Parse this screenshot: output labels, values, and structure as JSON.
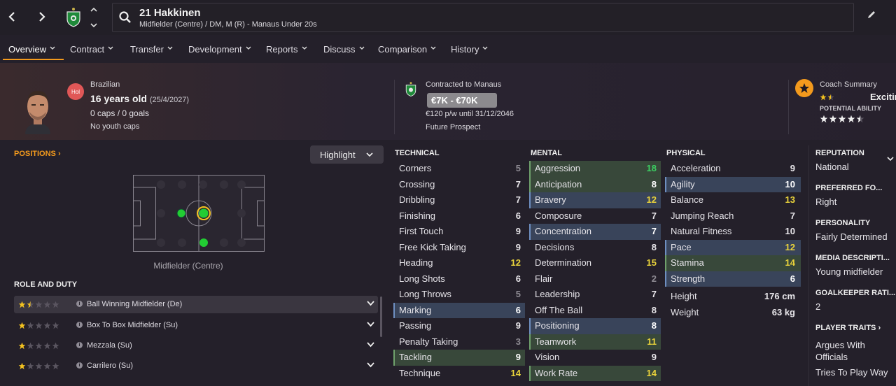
{
  "header": {
    "player_name": "21 Hakkinen",
    "player_sub": "Midfielder (Centre) / DM, M (R) - Manaus Under 20s"
  },
  "tabs": [
    {
      "label": "Overview"
    },
    {
      "label": "Contract"
    },
    {
      "label": "Transfer"
    },
    {
      "label": "Development"
    },
    {
      "label": "Reports"
    },
    {
      "label": "Discuss"
    },
    {
      "label": "Comparison"
    },
    {
      "label": "History"
    }
  ],
  "profile": {
    "badge": "Hol",
    "nationality": "Brazilian",
    "age": "16 years old",
    "dob": "(25/4/2027)",
    "caps": "0 caps / 0 goals",
    "youth_caps": "No youth caps"
  },
  "contract": {
    "club": "Contracted to Manaus",
    "value": "€7K - €70K",
    "wage": "€120 p/w until 31/12/2046",
    "status": "Future Prospect"
  },
  "coach": {
    "title": "Coach Summary",
    "verdict": "Excitin",
    "potential_label": "POTENTIAL ABILITY",
    "current_stars": 1.5,
    "potential_stars": 4.5
  },
  "positions": {
    "label": "POSITIONS",
    "highlight": "Highlight",
    "pitch_label": "Midfielder (Centre)"
  },
  "roles": {
    "header": "ROLE AND DUTY",
    "items": [
      {
        "name": "Ball Winning Midfielder (De)",
        "stars": 1.5
      },
      {
        "name": "Box To Box Midfielder (Su)",
        "stars": 1
      },
      {
        "name": "Mezzala (Su)",
        "stars": 1
      },
      {
        "name": "Carrilero (Su)",
        "stars": 1
      }
    ]
  },
  "technical": {
    "header": "TECHNICAL",
    "rows": [
      {
        "name": "Corners",
        "value": "5"
      },
      {
        "name": "Crossing",
        "value": "7"
      },
      {
        "name": "Dribbling",
        "value": "7"
      },
      {
        "name": "Finishing",
        "value": "6"
      },
      {
        "name": "First Touch",
        "value": "9"
      },
      {
        "name": "Free Kick Taking",
        "value": "9"
      },
      {
        "name": "Heading",
        "value": "12"
      },
      {
        "name": "Long Shots",
        "value": "6"
      },
      {
        "name": "Long Throws",
        "value": "5"
      },
      {
        "name": "Marking",
        "value": "6"
      },
      {
        "name": "Passing",
        "value": "9"
      },
      {
        "name": "Penalty Taking",
        "value": "3"
      },
      {
        "name": "Tackling",
        "value": "9"
      },
      {
        "name": "Technique",
        "value": "14"
      }
    ]
  },
  "mental": {
    "header": "MENTAL",
    "rows": [
      {
        "name": "Aggression",
        "value": "18"
      },
      {
        "name": "Anticipation",
        "value": "8"
      },
      {
        "name": "Bravery",
        "value": "12"
      },
      {
        "name": "Composure",
        "value": "7"
      },
      {
        "name": "Concentration",
        "value": "7"
      },
      {
        "name": "Decisions",
        "value": "8"
      },
      {
        "name": "Determination",
        "value": "15"
      },
      {
        "name": "Flair",
        "value": "2"
      },
      {
        "name": "Leadership",
        "value": "7"
      },
      {
        "name": "Off The Ball",
        "value": "8"
      },
      {
        "name": "Positioning",
        "value": "8"
      },
      {
        "name": "Teamwork",
        "value": "11"
      },
      {
        "name": "Vision",
        "value": "9"
      },
      {
        "name": "Work Rate",
        "value": "14"
      }
    ]
  },
  "physical": {
    "header": "PHYSICAL",
    "rows": [
      {
        "name": "Acceleration",
        "value": "9"
      },
      {
        "name": "Agility",
        "value": "10"
      },
      {
        "name": "Balance",
        "value": "13"
      },
      {
        "name": "Jumping Reach",
        "value": "7"
      },
      {
        "name": "Natural Fitness",
        "value": "10"
      },
      {
        "name": "Pace",
        "value": "12"
      },
      {
        "name": "Stamina",
        "value": "14"
      },
      {
        "name": "Strength",
        "value": "6"
      }
    ],
    "height_label": "Height",
    "height": "176 cm",
    "weight_label": "Weight",
    "weight": "63 kg"
  },
  "sidebar": {
    "reputation_label": "REPUTATION",
    "reputation": "National",
    "foot_label": "PREFERRED FO...",
    "foot": "Right",
    "personality_label": "PERSONALITY",
    "personality": "Fairly Determined",
    "media_label": "MEDIA DESCRIPTI...",
    "media": "Young midfielder",
    "gk_label": "GOALKEEPER RATI...",
    "gk": "2",
    "traits_label": "PLAYER TRAITS",
    "trait1": "Argues With",
    "trait1b": "Officials",
    "trait2": "Tries To Play Way"
  },
  "colors": {
    "accent": "#f39a1d",
    "stat_green": "#3ccf62",
    "stat_yellow": "#e8d23b",
    "stat_grey": "#8d8a92",
    "highlight_blue": "#39445a",
    "highlight_green": "#38483a"
  }
}
